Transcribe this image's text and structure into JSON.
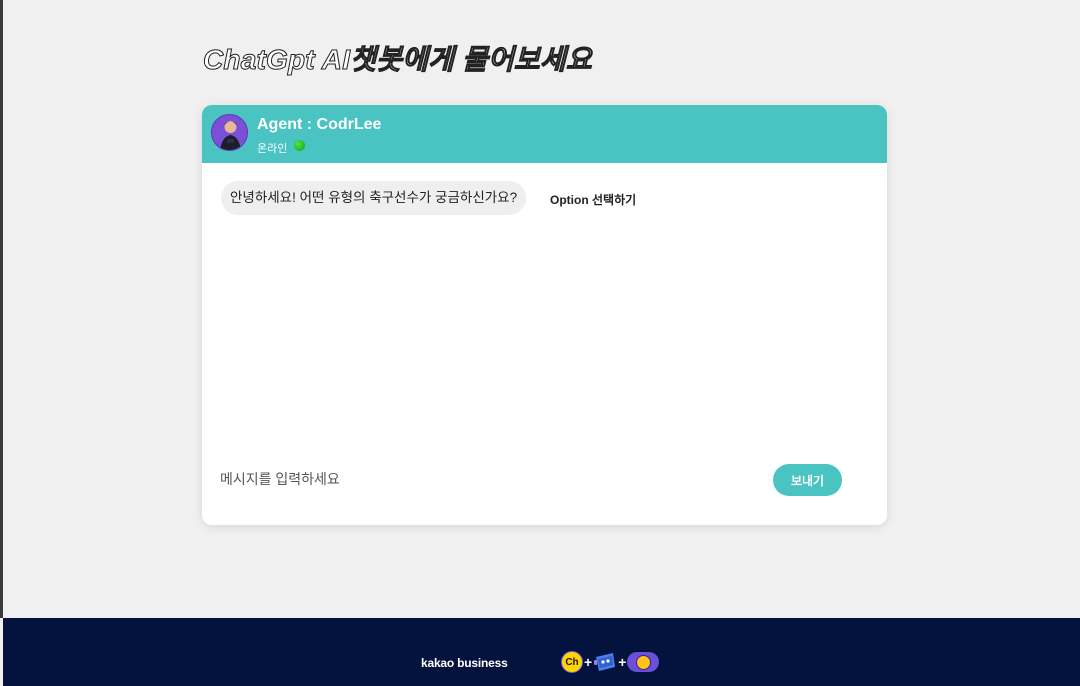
{
  "page": {
    "title": "ChatGpt AI챗봇에게 물어보세요"
  },
  "chat": {
    "agent_name": "Agent : CodrLee",
    "status": "온라인",
    "status_color": "#22c922",
    "accent_color": "#4ac3c3",
    "messages": [
      {
        "sender": "bot",
        "text": "안녕하세요! 어떤 유형의 축구선수가 궁금하신가요?"
      }
    ],
    "option_label": "Option 선택하기",
    "input": {
      "value": "",
      "placeholder": "메시지를 입력하세요"
    },
    "send_label": "보내기"
  },
  "footer": {
    "brand": "kakao business",
    "background_color": "#04133e",
    "icons": [
      "kakao-channel-icon",
      "chatbot-icon",
      "kakao-pay-coin-icon"
    ],
    "channel_badge": "Ch"
  }
}
